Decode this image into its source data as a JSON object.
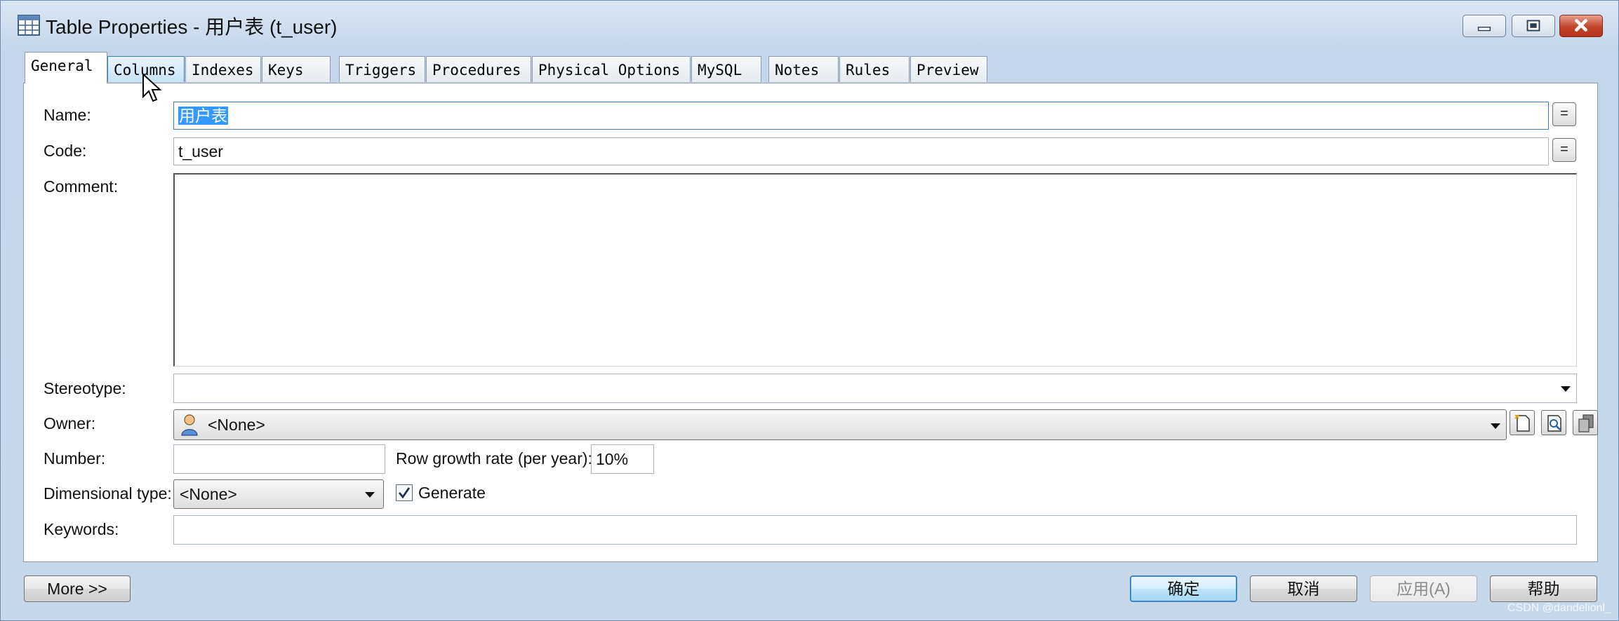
{
  "window": {
    "title": "Table Properties - 用户表 (t_user)",
    "icons": {
      "title": "table-icon",
      "minimize": "minimize-icon",
      "maximize": "maximize-icon",
      "close": "close-icon"
    }
  },
  "tabs": [
    {
      "label": "General"
    },
    {
      "label": "Columns"
    },
    {
      "label": "Indexes"
    },
    {
      "label": "Keys"
    },
    {
      "label": "Triggers"
    },
    {
      "label": "Procedures"
    },
    {
      "label": "Physical Options"
    },
    {
      "label": "MySQL"
    },
    {
      "label": "Notes"
    },
    {
      "label": "Rules"
    },
    {
      "label": "Preview"
    }
  ],
  "general": {
    "name_label": "Name:",
    "name_value": "用户表",
    "code_label": "Code:",
    "code_value": "t_user",
    "eq_button": "=",
    "comment_label": "Comment:",
    "comment_value": "",
    "stereotype_label": "Stereotype:",
    "stereotype_value": "",
    "owner_label": "Owner:",
    "owner_value": "<None>",
    "number_label": "Number:",
    "number_value": "",
    "row_growth_label": "Row growth rate (per year):",
    "row_growth_value": "10%",
    "dimensional_label": "Dimensional type:",
    "dimensional_value": "<None>",
    "generate_label": "Generate",
    "generate_checked": true,
    "keywords_label": "Keywords:",
    "keywords_value": ""
  },
  "footer": {
    "more": "More >>",
    "ok": "确定",
    "cancel": "取消",
    "apply": "应用(A)",
    "help": "帮助"
  },
  "watermark": "CSDN @dandelionl_",
  "colors": {
    "selection": "#3399ff",
    "accent": "#3a88c9",
    "close": "#c2452a"
  }
}
